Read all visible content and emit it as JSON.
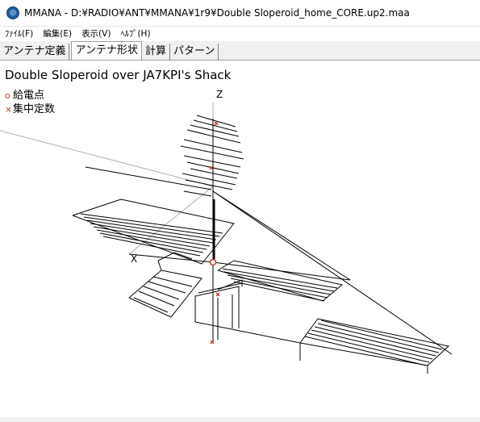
{
  "window": {
    "title": "MMANA - D:¥RADIO¥ANT¥MMANA¥1r9¥Double Sloperoid_home_CORE.up2.maa"
  },
  "menu": {
    "items": [
      "ﾌｧｲﾙ(F)",
      "編集(E)",
      "表示(V)",
      "ﾍﾙﾌﾟ(H)"
    ]
  },
  "tabs": {
    "items": [
      "アンテナ定義",
      "アンテナ形状",
      "計算",
      "パターン"
    ],
    "active": "アンテナ形状"
  },
  "view": {
    "antenna_name": "Double Sloperoid over JA7KPI's Shack",
    "legend_feed": "給電点",
    "legend_load": "集中定数",
    "axis_z": "Z",
    "axis_x": "X",
    "colors": {
      "feed": "#c0392b",
      "load": "#c0392b",
      "wire": "#000000",
      "axis": "#b0b0b0"
    }
  }
}
